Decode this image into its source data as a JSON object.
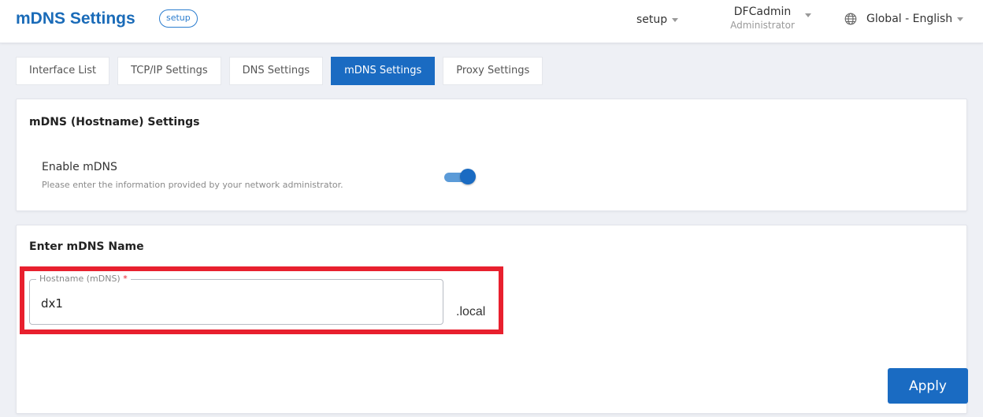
{
  "header": {
    "title": "mDNS Settings",
    "badge": "setup",
    "setup_menu": "setup",
    "user_name": "DFCadmin",
    "user_role": "Administrator",
    "language": "Global - English"
  },
  "tabs": [
    {
      "label": "Interface List",
      "active": false
    },
    {
      "label": "TCP/IP Settings",
      "active": false
    },
    {
      "label": "DNS Settings",
      "active": false
    },
    {
      "label": "mDNS Settings",
      "active": true
    },
    {
      "label": "Proxy Settings",
      "active": false
    }
  ],
  "mdns_section": {
    "title": "mDNS (Hostname) Settings",
    "enable_label": "Enable mDNS",
    "help_text": "Please enter the information provided by your network administrator.",
    "enabled": true
  },
  "name_section": {
    "title": "Enter mDNS Name",
    "field_label": "Hostname (mDNS)",
    "required_mark": "*",
    "hostname_value": "dx1",
    "suffix": ".local",
    "apply_label": "Apply"
  },
  "colors": {
    "accent": "#1a6bc2",
    "highlight": "#e8202e"
  }
}
